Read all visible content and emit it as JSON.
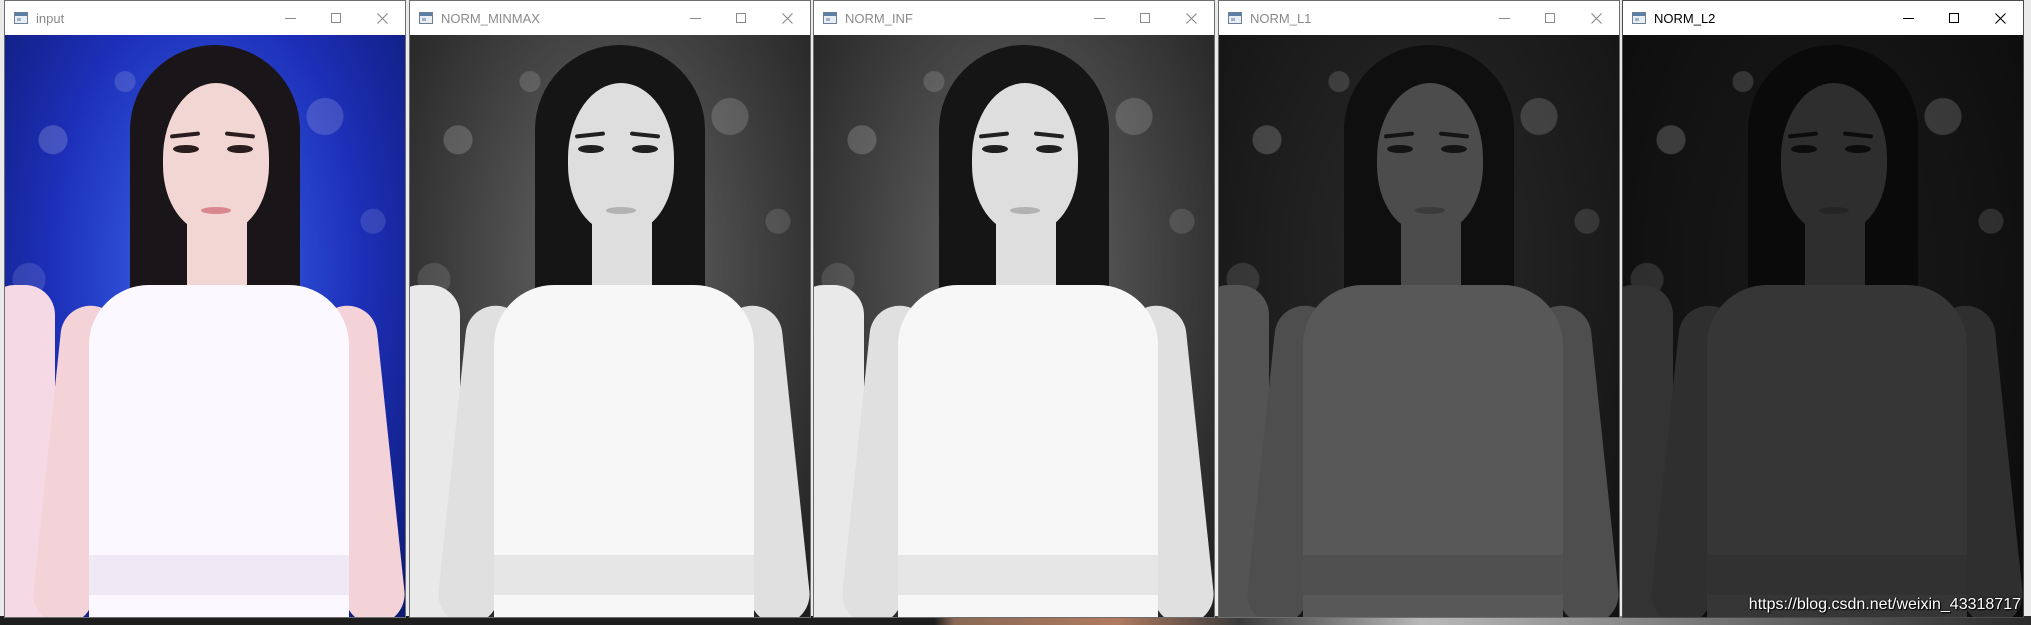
{
  "windows": [
    {
      "title": "input",
      "variant": "color",
      "active": false
    },
    {
      "title": "NORM_MINMAX",
      "variant": "gray",
      "active": false
    },
    {
      "title": "NORM_INF",
      "variant": "gray",
      "active": false
    },
    {
      "title": "NORM_L1",
      "variant": "dark1",
      "active": false
    },
    {
      "title": "NORM_L2",
      "variant": "dark2",
      "active": true
    }
  ],
  "controls": {
    "minimize_icon": "minimize-icon",
    "maximize_icon": "maximize-icon",
    "close_icon": "close-icon"
  },
  "watermark": "https://blog.csdn.net/weixin_43318717"
}
